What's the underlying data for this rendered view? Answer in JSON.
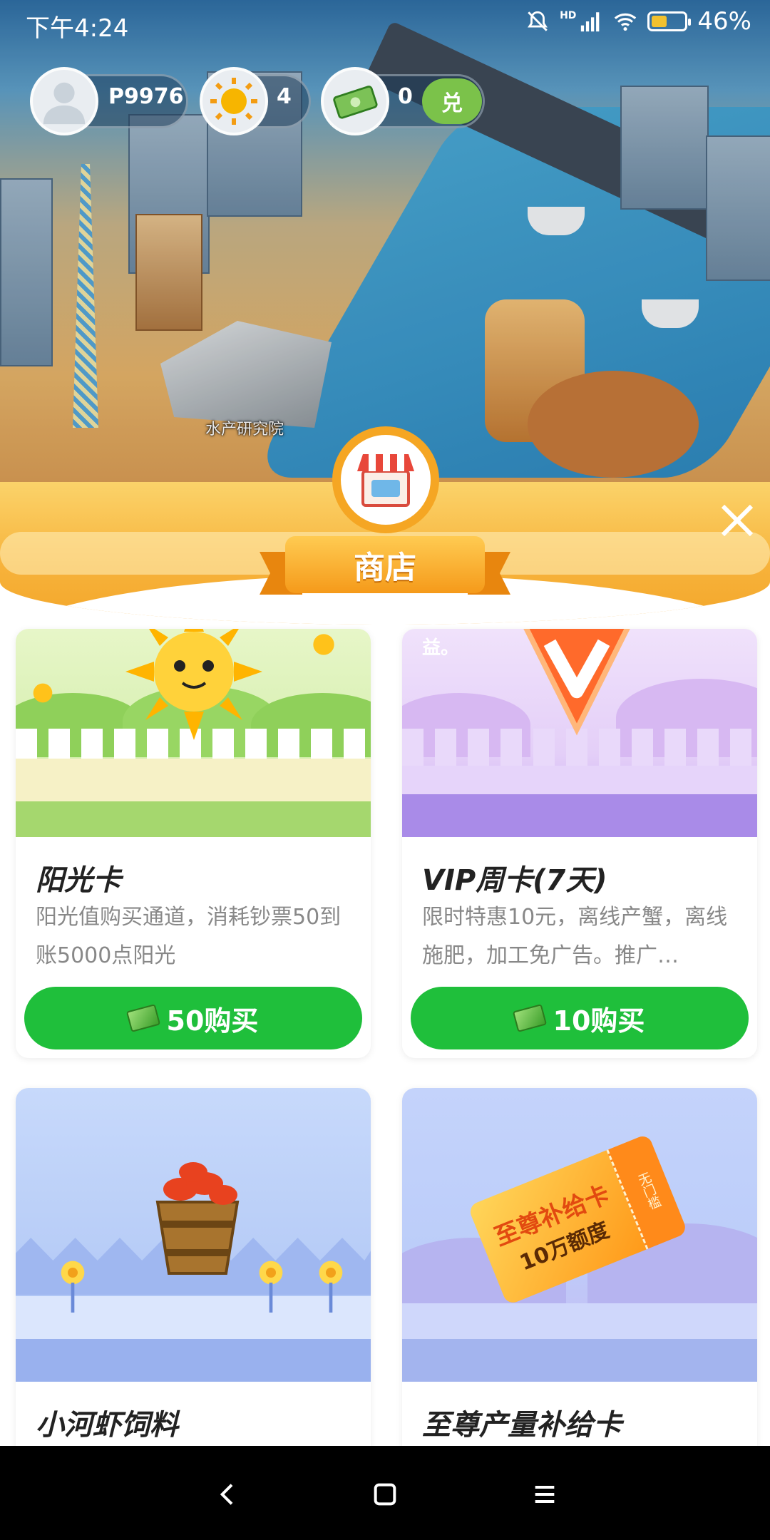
{
  "status_bar": {
    "time": "下午4:24",
    "network": "HD",
    "battery": "46%",
    "battery_level": 0.46
  },
  "player": {
    "name": "P9976",
    "sun_count": "4",
    "cash_count": "0",
    "exchange_label": "兑"
  },
  "scene": {
    "building_label": "水产研究院"
  },
  "shop": {
    "title": "商店"
  },
  "cards": [
    {
      "title": "阳光卡",
      "description": "阳光值购买通道，消耗钞票50到账5000点阳光",
      "price_label": "50购买"
    },
    {
      "title": "VIP周卡(7天)",
      "art_caption": "益。",
      "description": "限时特惠10元，离线产蟹，离线施肥，加工免广告。推广…",
      "price_label": "10购买"
    },
    {
      "title": "小河虾饲料"
    },
    {
      "title": "至尊产量补给卡",
      "ticket_line1": "至尊补给卡",
      "ticket_line2": "10万额度",
      "ticket_stub": "无门槛"
    }
  ],
  "colors": {
    "buy_button": "#1fbf3b",
    "shop_orange": "#f5a623",
    "exchange_button": "#7bc24a"
  }
}
